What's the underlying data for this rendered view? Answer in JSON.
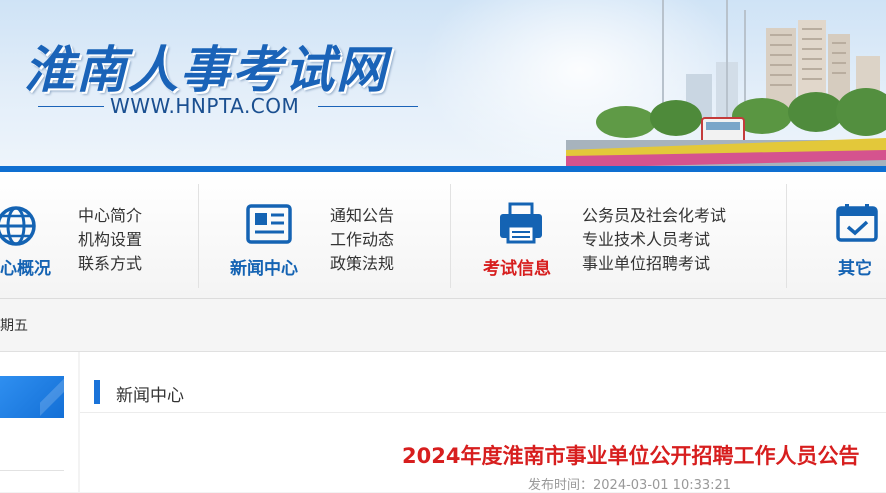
{
  "header": {
    "site_title": "淮南人事考试网",
    "site_url": "WWW.HNPTA.COM"
  },
  "nav": [
    {
      "title": "心概况",
      "icon": "globe-icon",
      "links": [
        "中心简介",
        "机构设置",
        "联系方式"
      ]
    },
    {
      "title": "新闻中心",
      "icon": "newspaper-icon",
      "links": [
        "通知公告",
        "工作动态",
        "政策法规"
      ]
    },
    {
      "title": "考试信息",
      "icon": "exam-printer-icon",
      "links": [
        "公务员及社会化考试",
        "专业技术人员考试",
        "事业单位招聘考试"
      ]
    },
    {
      "title": "其它",
      "icon": "calendar-check-icon",
      "links": []
    }
  ],
  "date_strip": {
    "text": "期五"
  },
  "section": {
    "title": "新闻中心"
  },
  "article": {
    "title": "2024年度淮南市事业单位公开招聘工作人员公告",
    "publish_time": "发布时间：2024-03-01 10:33:21"
  },
  "colors": {
    "brand_blue": "#1a63b8",
    "nav_blue": "#1463b3",
    "active_red": "#d71e1e",
    "accent_blue": "#1a73d9"
  }
}
